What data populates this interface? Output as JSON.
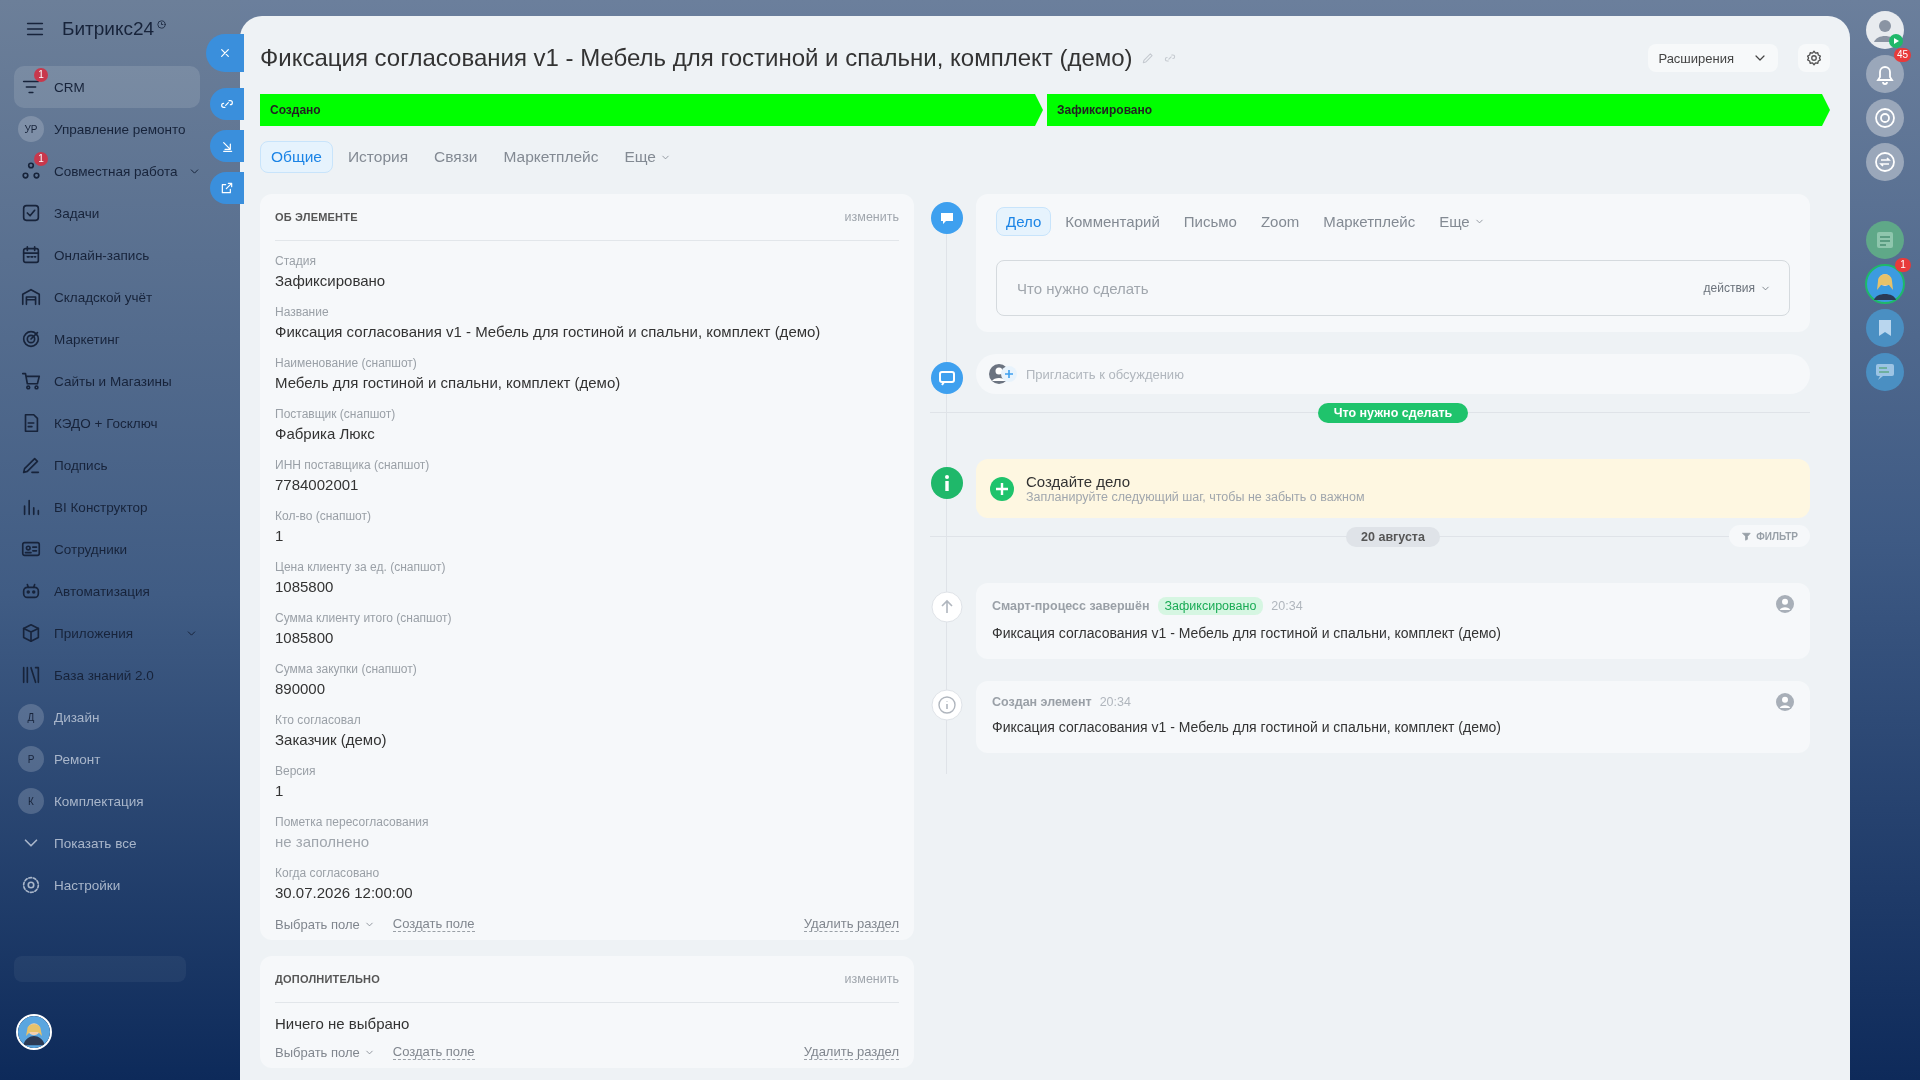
{
  "sidebar": {
    "logo": "Битрикс24",
    "items": [
      {
        "label": "CRM",
        "badge": "1",
        "selected": true
      },
      {
        "label": "Управление ремонто",
        "initials": "УР",
        "selected": false
      },
      {
        "label": "Совместная работа",
        "badge": "1",
        "expandable": true,
        "selected": false
      },
      {
        "label": "Задачи",
        "selected": false
      },
      {
        "label": "Онлайн-запись",
        "selected": false
      },
      {
        "label": "Складской учёт",
        "selected": false
      },
      {
        "label": "Маркетинг",
        "selected": false
      },
      {
        "label": "Сайты и Магазины",
        "selected": false
      },
      {
        "label": "КЭДО + Госключ",
        "selected": false
      },
      {
        "label": "Подпись",
        "selected": false
      },
      {
        "label": "BI Конструктор",
        "selected": false
      },
      {
        "label": "Сотрудники",
        "selected": false
      },
      {
        "label": "Автоматизация",
        "selected": false
      },
      {
        "label": "Приложения",
        "expandable": true,
        "selected": false
      },
      {
        "label": "База знаний 2.0",
        "selected": false
      },
      {
        "label": "Дизайн",
        "initials": "Д",
        "selected": false
      },
      {
        "label": "Ремонт",
        "initials": "Р",
        "selected": false
      },
      {
        "label": "Комплектация",
        "initials": "К",
        "selected": false
      },
      {
        "label": "Показать все",
        "selected": false
      },
      {
        "label": "Настройки",
        "selected": false
      }
    ]
  },
  "header": {
    "title": "Фиксация согласования v1 - Мебель для гостиной и спальни, комплект (демо)",
    "extensions_button": "Расширения"
  },
  "stages": [
    {
      "label": "Создано",
      "passed": true
    },
    {
      "label": "Зафиксировано",
      "passed": true
    }
  ],
  "tabs": [
    {
      "label": "Общие",
      "selected": true
    },
    {
      "label": "История",
      "selected": false
    },
    {
      "label": "Связи",
      "selected": false
    },
    {
      "label": "Маркетплейс",
      "selected": false
    },
    {
      "label": "Еще",
      "selected": false,
      "dropdown": true
    }
  ],
  "sections": [
    {
      "title": "ОБ ЭЛЕМЕНТЕ",
      "edit": "изменить",
      "fields": [
        {
          "label": "Стадия",
          "value": "Зафиксировано",
          "empty": false
        },
        {
          "label": "Название",
          "value": "Фиксация согласования v1 - Мебель для гостиной и спальни, комплект (демо)",
          "empty": false
        },
        {
          "label": "Наименование (снапшот)",
          "value": "Мебель для гостиной и спальни, комплект (демо)",
          "empty": false
        },
        {
          "label": "Поставщик (снапшот)",
          "value": "Фабрика Люкс",
          "empty": false
        },
        {
          "label": "ИНН поставщика (снапшот)",
          "value": "7784002001",
          "empty": false
        },
        {
          "label": "Кол-во (снапшот)",
          "value": "1",
          "empty": false
        },
        {
          "label": "Цена клиенту за ед. (снапшот)",
          "value": "1085800",
          "empty": false
        },
        {
          "label": "Сумма клиенту итого (снапшот)",
          "value": "1085800",
          "empty": false
        },
        {
          "label": "Сумма закупки (снапшот)",
          "value": "890000",
          "empty": false
        },
        {
          "label": "Кто согласовал",
          "value": "Заказчик (демо)",
          "empty": false
        },
        {
          "label": "Версия",
          "value": "1",
          "empty": false
        },
        {
          "label": "Пометка пересогласования",
          "value": "не заполнено",
          "empty": true
        },
        {
          "label": "Когда согласовано",
          "value": "30.07.2026 12:00:00",
          "empty": false
        }
      ],
      "select_field": "Выбрать поле",
      "create_field": "Создать поле",
      "delete_section": "Удалить раздел"
    },
    {
      "title": "ДОПОЛНИТЕЛЬНО",
      "edit": "изменить",
      "note": "Ничего не выбрано",
      "select_field": "Выбрать поле",
      "create_field": "Создать поле",
      "delete_section": "Удалить раздел"
    }
  ],
  "activity": {
    "tabs": [
      {
        "label": "Дело",
        "selected": true
      },
      {
        "label": "Комментарий",
        "selected": false
      },
      {
        "label": "Письмо",
        "selected": false
      },
      {
        "label": "Zoom",
        "selected": false
      },
      {
        "label": "Маркетплейс",
        "selected": false
      },
      {
        "label": "Еще",
        "selected": false,
        "dropdown": true
      }
    ],
    "placeholder": "Что нужно сделать",
    "actions": "действия",
    "invite": "Пригласить к обсуждению"
  },
  "todo_divider": "Что нужно сделать",
  "todo": {
    "title": "Создайте дело",
    "hint": "Запланируйте следующий шаг, чтобы не забыть о важном"
  },
  "date_divider": "20 августа",
  "filter": "ФИЛЬТР",
  "events": [
    {
      "kind": "stage",
      "title": "Смарт-процесс завершён",
      "badge": "Зафиксировано",
      "time": "20:34",
      "text": "Фиксация согласования v1 - Мебель для гостиной и спальни, комплект (демо)"
    },
    {
      "kind": "created",
      "title": "Создан элемент",
      "time": "20:34",
      "text": "Фиксация согласования v1 - Мебель для гостиной и спальни, комплект (демо)"
    }
  ],
  "right_bar": [
    {
      "kind": "user"
    },
    {
      "kind": "bell",
      "badge": "45"
    },
    {
      "kind": "target"
    },
    {
      "kind": "chat-swap"
    },
    {
      "kind": "news"
    },
    {
      "kind": "avatar",
      "badge": "1"
    },
    {
      "kind": "bookmark"
    },
    {
      "kind": "messages"
    }
  ]
}
